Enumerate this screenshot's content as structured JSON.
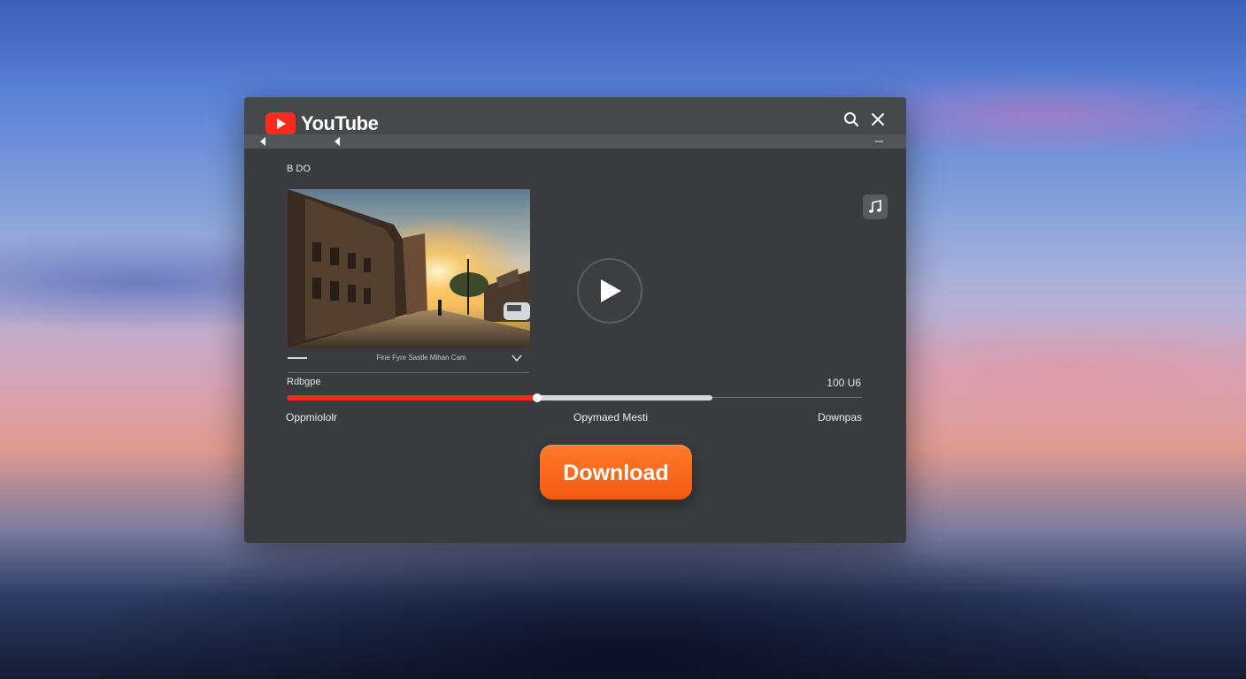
{
  "app": {
    "brand": "YouTube"
  },
  "header": {
    "search_icon": "search-icon",
    "close_icon": "close-icon"
  },
  "section": {
    "label": "B DO"
  },
  "video": {
    "caption": "Fine Fyre Sastle Mihan Cam",
    "play_icon": "play-icon",
    "music_icon": "music-note-icon"
  },
  "range": {
    "label": "Rdbgpe",
    "value": "100 U6",
    "progress": 0.43,
    "buffered": 0.74
  },
  "options": {
    "left": "Oppmiololr",
    "center": "Opymaed Mesti",
    "right": "Downpas"
  },
  "actions": {
    "download_label": "Download"
  },
  "colors": {
    "accent": "#ef2a22",
    "button": "#f25a12",
    "window": "#3a3b3e"
  }
}
